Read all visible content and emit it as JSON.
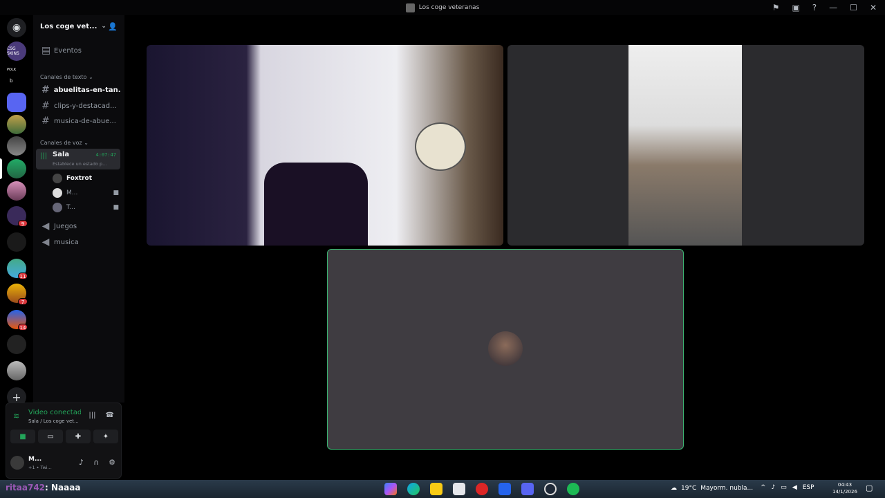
{
  "window": {
    "title": "Los coge veteranas"
  },
  "guilds": {
    "badges": [
      "9",
      "11",
      "7",
      "14"
    ],
    "labels": [
      "CSG SKINS",
      "POLK",
      "b"
    ]
  },
  "server": {
    "name": "Los coge vet..."
  },
  "sidebar": {
    "events_label": "Eventos",
    "text_category": "Canales de texto",
    "text_channels": [
      "abuelitas-en-tan...",
      "clips-y-destacad...",
      "musica-de-abue..."
    ],
    "voice_category": "Canales de voz",
    "active_voice": {
      "name": "Sala",
      "timer": "4:07:47",
      "status": "Establece un estado p..."
    },
    "members": [
      {
        "name": "Foxtrot"
      },
      {
        "name": "M..."
      },
      {
        "name": "T..."
      }
    ],
    "voice_channels": [
      "Juegos",
      "musica"
    ]
  },
  "voice_panel": {
    "status": "Video conectado",
    "location": "Sala / Los coge vet...",
    "user_name": "M...",
    "activity": "+1 • Twi..."
  },
  "taskbar": {
    "chat_user": "ritaa742",
    "chat_message": ": Naaaa",
    "weather": "19°C",
    "weather_desc": "Mayorm. nubla...",
    "lang": "ESP",
    "time": "04:43",
    "date": "14/1/2026"
  },
  "colors": {
    "accent_green": "#23a55a",
    "background": "#000000",
    "speaking_border": "#3cb371"
  }
}
